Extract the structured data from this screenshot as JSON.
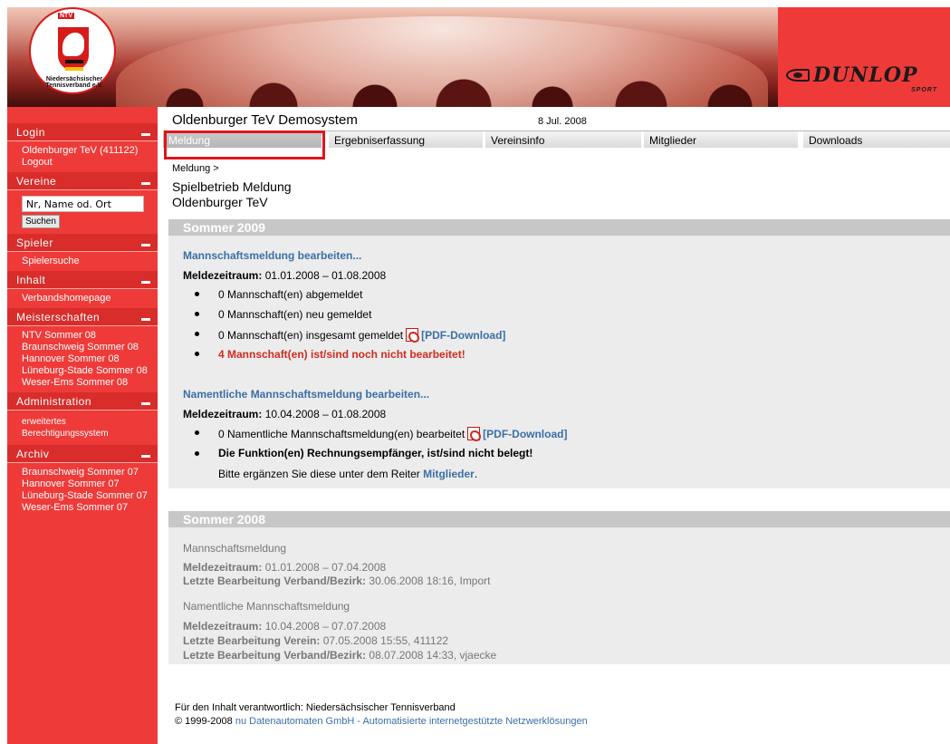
{
  "header": {
    "ntv_logo_text": "NTV",
    "ntv_ring_text": "Niedersächsischer Tennisverband e.V.",
    "sponsor": "DUNLOP",
    "sponsor_sub": "SPORT"
  },
  "sidebar": {
    "login": {
      "title": "Login",
      "items": [
        "Oldenburger TeV (411122)",
        "Logout"
      ]
    },
    "vereine": {
      "title": "Vereine",
      "search_value": "Nr, Name od. Ort",
      "search_button": "Suchen"
    },
    "spieler": {
      "title": "Spieler",
      "items": [
        "Spielersuche"
      ]
    },
    "inhalt": {
      "title": "Inhalt",
      "items": [
        "Verbandshomepage"
      ]
    },
    "meisterschaften": {
      "title": "Meisterschaften",
      "items": [
        "NTV Sommer 08",
        "Braunschweig Sommer 08",
        "Hannover Sommer 08",
        "Lüneburg-Stade Sommer 08",
        "Weser-Ems Sommer 08"
      ]
    },
    "administration": {
      "title": "Administration",
      "items": [
        "erweitertes Berechtigungssystem"
      ]
    },
    "archiv": {
      "title": "Archiv",
      "items": [
        "Braunschweig Sommer 07",
        "Hannover Sommer 07",
        "Lüneburg-Stade Sommer 07",
        "Weser-Ems Sommer 07"
      ]
    }
  },
  "main": {
    "org_title": "Oldenburger TeV  Demosystem",
    "date": "8 Jul. 2008",
    "tabs": [
      {
        "label": "Meldung",
        "active": true
      },
      {
        "label": "Ergebniserfassung"
      },
      {
        "label": "Vereinsinfo"
      },
      {
        "label": "Mitglieder"
      },
      {
        "label": "Downloads"
      }
    ],
    "breadcrumb": "Meldung >",
    "page_title_1": "Spielbetrieb Meldung",
    "page_title_2": "Oldenburger TeV"
  },
  "season_2009": {
    "title": "Sommer 2009",
    "team_link": "Mannschaftsmeldung bearbeiten...",
    "team_period_label": "Meldezeitraum:",
    "team_period_value": "01.01.2008 – 01.08.2008",
    "team_items": [
      "0 Mannschaft(en) abgemeldet",
      "0 Mannschaft(en) neu gemeldet",
      "0 Mannschaft(en) insgesamt gemeldet"
    ],
    "pdf_download": "[PDF-Download]",
    "team_warning": "4 Mannschaft(en) ist/sind noch nicht bearbeitet!",
    "named_link": "Namentliche Mannschaftsmeldung bearbeiten...",
    "named_period_label": "Meldezeitraum:",
    "named_period_value": "10.04.2008 – 01.08.2008",
    "named_item": "0 Namentliche Mannschaftsmeldung(en) bearbeitet",
    "named_warning": "Die Funktion(en) Rechnungsempfänger, ist/sind nicht belegt!",
    "named_hint_prefix": "Bitte ergänzen Sie diese unter dem Reiter",
    "named_hint_link": "Mitglieder",
    "named_hint_suffix": "."
  },
  "season_2008": {
    "title": "Sommer 2008",
    "team_heading": "Mannschaftsmeldung",
    "team_period_label": "Meldezeitraum:",
    "team_period_value": "01.01.2008 – 07.04.2008",
    "team_last_label": "Letzte Bearbeitung Verband/Bezirk:",
    "team_last_value": "30.06.2008 18:16, Import",
    "named_heading": "Namentliche Mannschaftsmeldung",
    "named_period_label": "Meldezeitraum:",
    "named_period_value": "10.04.2008 – 07.07.2008",
    "named_last_verein_label": "Letzte Bearbeitung Verein:",
    "named_last_verein_value": "07.05.2008 15:55, 411122",
    "named_last_verband_label": "Letzte Bearbeitung Verband/Bezirk:",
    "named_last_verband_value": "08.07.2008 14:33, vjaecke"
  },
  "footer": {
    "line1": "Für den Inhalt verantwortlich: Niedersächsischer Tennisverband",
    "copyright": "© 1999-2008",
    "company_link": "nu Datenautomaten GmbH - Automatisierte internetgestützte Netzwerklösungen"
  }
}
